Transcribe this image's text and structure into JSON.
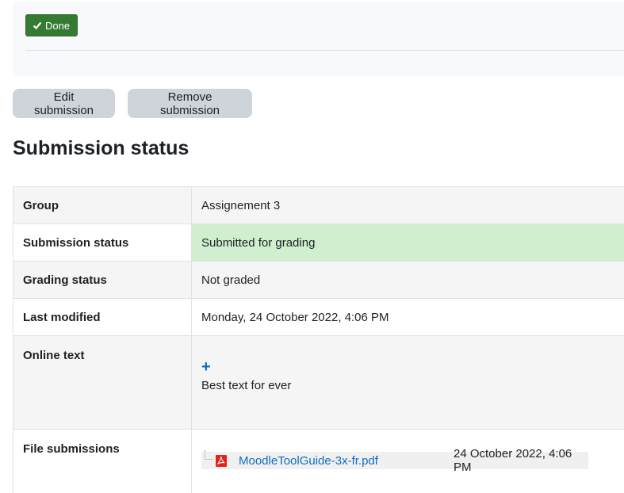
{
  "completion": {
    "done_label": "Done",
    "done_color": "#357a32"
  },
  "actions": {
    "edit_label": "Edit submission",
    "remove_label": "Remove submission"
  },
  "heading": "Submission status",
  "rows": [
    {
      "label": "Group",
      "value": "Assignement 3"
    },
    {
      "label": "Submission status",
      "value": "Submitted for grading",
      "highlight_color": "#cfefcf"
    },
    {
      "label": "Grading status",
      "value": "Not graded"
    },
    {
      "label": "Last modified",
      "value": "Monday, 24 October 2022, 4:06 PM"
    },
    {
      "label": "Online text",
      "value": "Best text for ever",
      "icon": "plus-icon"
    },
    {
      "label": "File submissions",
      "file": {
        "name": "MoodleToolGuide-3x-fr.pdf",
        "date": "24 October 2022, 4:06 PM",
        "icon": "pdf-icon"
      }
    }
  ],
  "colors": {
    "link": "#0f6cbf",
    "button_bg": "#ced4da"
  }
}
